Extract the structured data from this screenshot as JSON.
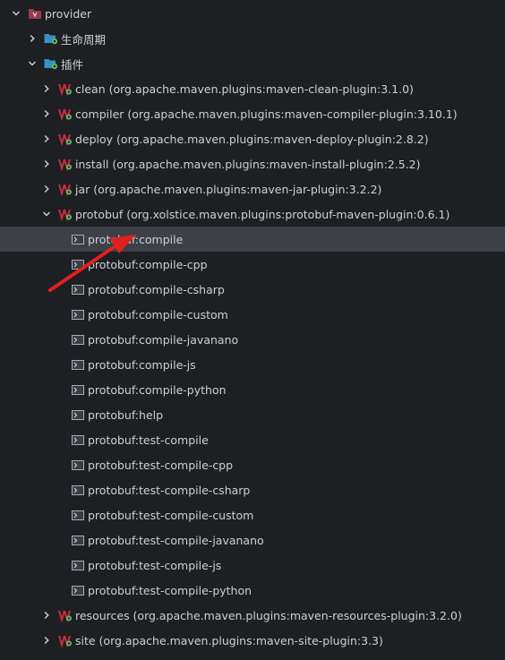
{
  "tree": {
    "project": {
      "label": "provider",
      "icon": "maven-project-icon",
      "expanded": true
    },
    "lifecycle": {
      "label": "生命周期",
      "icon": "folder-gear-icon",
      "expanded": false
    },
    "plugins_folder": {
      "label": "插件",
      "icon": "folder-gear-icon",
      "expanded": true
    },
    "plugins": [
      {
        "label": "clean (org.apache.maven.plugins:maven-clean-plugin:3.1.0)",
        "icon": "maven-plugin-icon",
        "expanded": false
      },
      {
        "label": "compiler (org.apache.maven.plugins:maven-compiler-plugin:3.10.1)",
        "icon": "maven-plugin-icon",
        "expanded": false
      },
      {
        "label": "deploy (org.apache.maven.plugins:maven-deploy-plugin:2.8.2)",
        "icon": "maven-plugin-icon",
        "expanded": false
      },
      {
        "label": "install (org.apache.maven.plugins:maven-install-plugin:2.5.2)",
        "icon": "maven-plugin-icon",
        "expanded": false
      },
      {
        "label": "jar (org.apache.maven.plugins:maven-jar-plugin:3.2.2)",
        "icon": "maven-plugin-icon",
        "expanded": false
      },
      {
        "label": "protobuf (org.xolstice.maven.plugins:protobuf-maven-plugin:0.6.1)",
        "icon": "maven-plugin-icon",
        "expanded": true
      }
    ],
    "goals": [
      {
        "label": "protobuf:compile",
        "icon": "goal-icon",
        "selected": true
      },
      {
        "label": "protobuf:compile-cpp",
        "icon": "goal-icon"
      },
      {
        "label": "protobuf:compile-csharp",
        "icon": "goal-icon"
      },
      {
        "label": "protobuf:compile-custom",
        "icon": "goal-icon"
      },
      {
        "label": "protobuf:compile-javanano",
        "icon": "goal-icon"
      },
      {
        "label": "protobuf:compile-js",
        "icon": "goal-icon"
      },
      {
        "label": "protobuf:compile-python",
        "icon": "goal-icon"
      },
      {
        "label": "protobuf:help",
        "icon": "goal-icon"
      },
      {
        "label": "protobuf:test-compile",
        "icon": "goal-icon"
      },
      {
        "label": "protobuf:test-compile-cpp",
        "icon": "goal-icon"
      },
      {
        "label": "protobuf:test-compile-csharp",
        "icon": "goal-icon"
      },
      {
        "label": "protobuf:test-compile-custom",
        "icon": "goal-icon"
      },
      {
        "label": "protobuf:test-compile-javanano",
        "icon": "goal-icon"
      },
      {
        "label": "protobuf:test-compile-js",
        "icon": "goal-icon"
      },
      {
        "label": "protobuf:test-compile-python",
        "icon": "goal-icon"
      }
    ],
    "plugins_after": [
      {
        "label": "resources (org.apache.maven.plugins:maven-resources-plugin:3.2.0)",
        "icon": "maven-plugin-icon",
        "expanded": false
      },
      {
        "label": "site (org.apache.maven.plugins:maven-site-plugin:3.3)",
        "icon": "maven-plugin-icon",
        "expanded": false
      }
    ]
  },
  "annotation": {
    "icon": "red-arrow-annotation",
    "color": "#e02020",
    "points_to": "protobuf:compile"
  },
  "colors": {
    "background": "#1e1f22",
    "selected_row": "#3d4047",
    "text": "#cdd0d5",
    "chevron": "#c9ccd1",
    "folder_blue": "#3592c4",
    "gear_green": "#5fb85a",
    "maven_red": "#c72c41",
    "goal_box": "#a8adb5"
  }
}
